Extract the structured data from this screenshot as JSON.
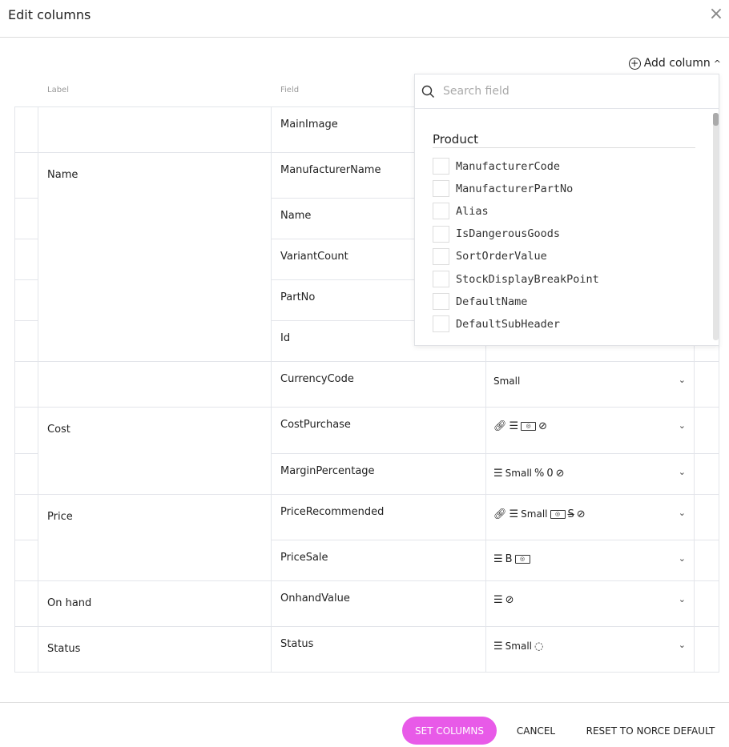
{
  "dialog": {
    "title": "Edit columns",
    "close": "×"
  },
  "add_column": {
    "label": "Add column",
    "chevron": "^"
  },
  "headers": {
    "label": "Label",
    "field": "Field"
  },
  "rows": [
    {
      "label": "",
      "field": "MainImage",
      "format": []
    },
    {
      "label": "Name",
      "field": "ManufacturerName",
      "format": []
    },
    {
      "label": "",
      "field": "Name",
      "format": []
    },
    {
      "label": "",
      "field": "VariantCount",
      "format": []
    },
    {
      "label": "",
      "field": "PartNo",
      "format": []
    },
    {
      "label": "",
      "field": "Id",
      "format": []
    },
    {
      "label": "",
      "field": "CurrencyCode",
      "format": [
        "Small"
      ]
    },
    {
      "label": "Cost",
      "field": "CostPurchase",
      "format": [
        "link-icon",
        "align-icon",
        "money-icon",
        "eye-off-icon"
      ]
    },
    {
      "label": "",
      "field": "MarginPercentage",
      "format": [
        "align-icon",
        "Small",
        "percent-icon",
        "zero-icon",
        "eye-off-icon"
      ]
    },
    {
      "label": "Price",
      "field": "PriceRecommended",
      "format": [
        "link-icon",
        "align-icon",
        "Small",
        "money-icon",
        "strikethrough-icon",
        "eye-off-icon"
      ]
    },
    {
      "label": "",
      "field": "PriceSale",
      "format": [
        "align-icon",
        "bold-icon",
        "money-icon"
      ]
    },
    {
      "label": "On hand",
      "field": "OnhandValue",
      "format": [
        "align-icon",
        "eye-off-icon"
      ]
    },
    {
      "label": "Status",
      "field": "Status",
      "format": [
        "align-icon",
        "Small",
        "status-circle-icon"
      ]
    }
  ],
  "dropdown": {
    "search_placeholder": "Search field",
    "group": "Product",
    "options": [
      "ManufacturerCode",
      "ManufacturerPartNo",
      "Alias",
      "IsDangerousGoods",
      "SortOrderValue",
      "StockDisplayBreakPoint",
      "DefaultName",
      "DefaultSubHeader"
    ]
  },
  "footer": {
    "set": "SET COLUMNS",
    "cancel": "CANCEL",
    "reset": "RESET TO NORCE DEFAULT"
  },
  "colors": {
    "primary": "#e85ae8"
  }
}
